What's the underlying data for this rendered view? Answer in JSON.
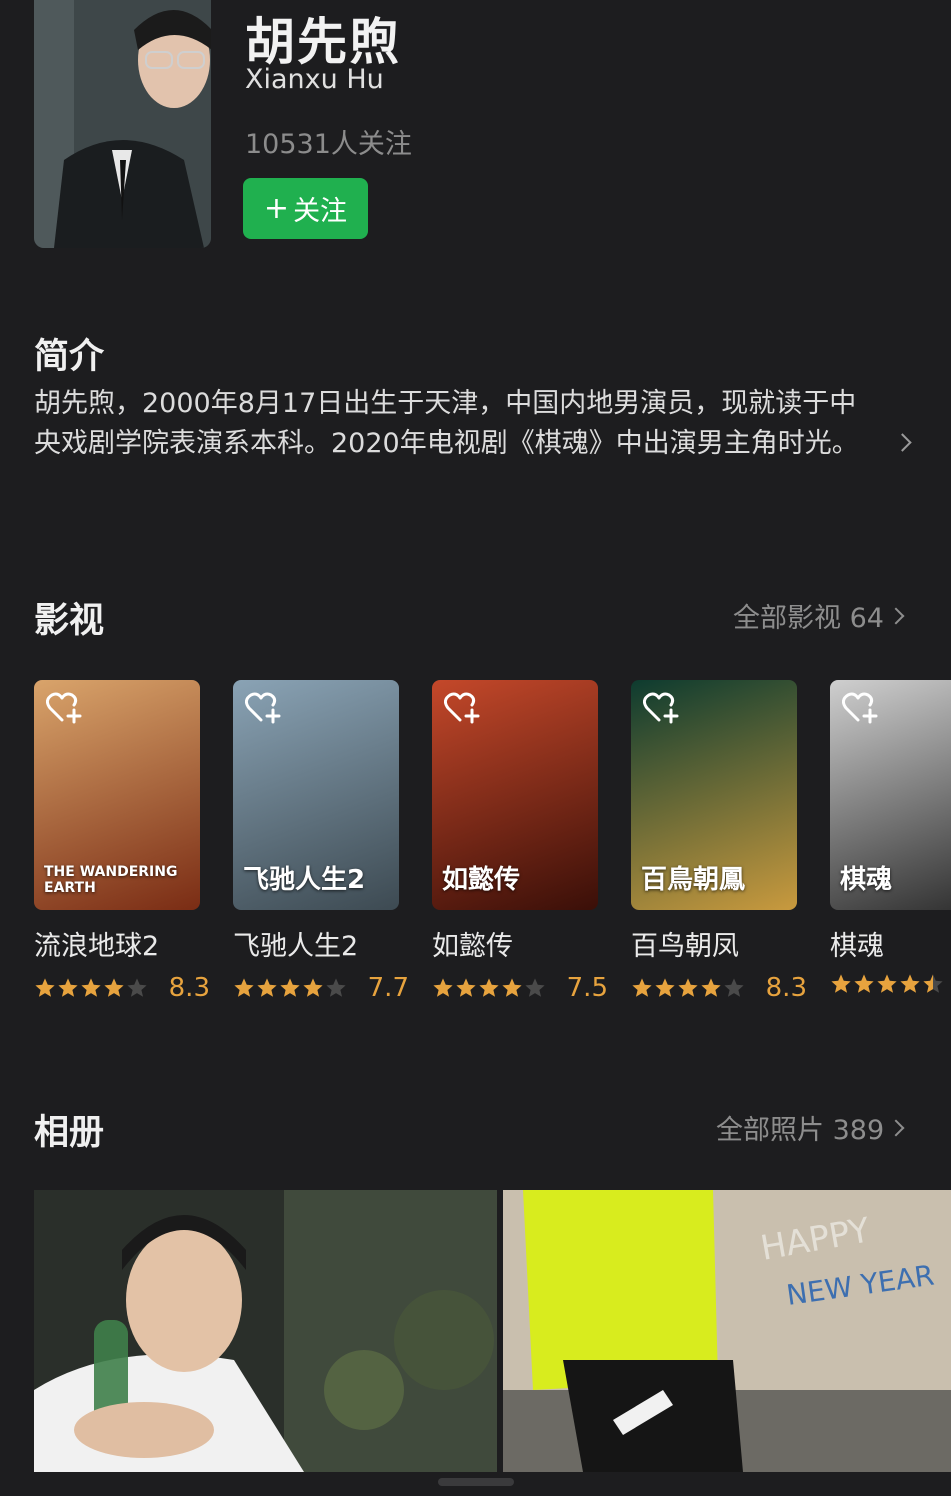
{
  "profile": {
    "name_cn": "胡先煦",
    "name_en": "Xianxu Hu",
    "followers": "10531人关注",
    "follow_label": "关注",
    "follow_icon": "plus-icon"
  },
  "intro": {
    "title": "简介",
    "text": "胡先煦，2000年8月17日出生于天津，中国内地男演员，现就读于中央戏剧学院表演系本科。2020年电视剧《棋魂》中出演男主角时光。"
  },
  "films": {
    "title": "影视",
    "more": "全部影视 64",
    "items": [
      {
        "title": "流浪地球2",
        "rating": 8.3,
        "score": "8.3",
        "stars": 4
      },
      {
        "title": "飞驰人生2",
        "rating": 7.7,
        "score": "7.7",
        "stars": 4
      },
      {
        "title": "如懿传",
        "rating": 7.5,
        "score": "7.5",
        "stars": 4
      },
      {
        "title": "百鸟朝凤",
        "rating": 8.3,
        "score": "8.3",
        "stars": 4
      },
      {
        "title": "棋魂",
        "rating": null,
        "score": "",
        "stars": 4.5
      }
    ],
    "posters": [
      {
        "caption": "THE WANDERING EARTH",
        "c1": "#d9a46b",
        "c2": "#7a2c14"
      },
      {
        "caption": "飞驰人生2",
        "c1": "#8aa3b5",
        "c2": "#3d4a52"
      },
      {
        "caption": "如懿传",
        "c1": "#c4482a",
        "c2": "#3a0f08"
      },
      {
        "caption": "百鳥朝鳳",
        "c1": "#0d3b2f",
        "c2": "#c99a3e"
      },
      {
        "caption": "棋魂",
        "c1": "#cfcfcf",
        "c2": "#2b2b2b"
      }
    ]
  },
  "album": {
    "title": "相册",
    "more": "全部照片 389",
    "photo2_text_1": "HAPPY",
    "photo2_text_2": "NEW YEAR"
  },
  "colors": {
    "background": "#1d1d1f",
    "accent_green": "#20b04f",
    "star": "#e7a33e",
    "star_empty": "#4a4a4a"
  }
}
